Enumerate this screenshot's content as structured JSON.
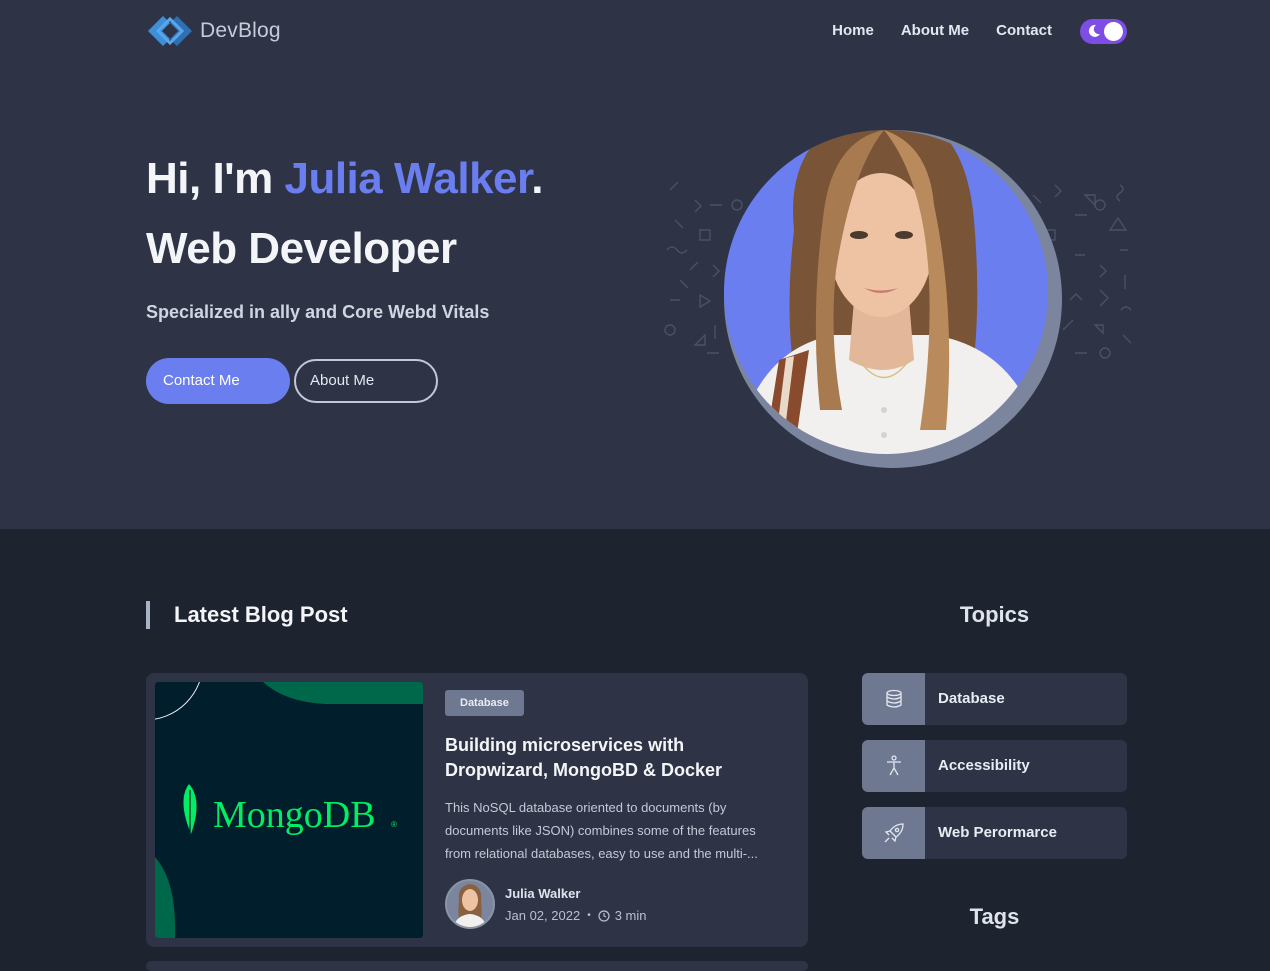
{
  "nav": {
    "brand": "DevBlog",
    "links": [
      {
        "label": "Home"
      },
      {
        "label": "About Me"
      },
      {
        "label": "Contact"
      }
    ],
    "theme_toggle_state": "dark"
  },
  "hero": {
    "greeting": "Hi, I'm ",
    "name": "Julia Walker",
    "name_suffix": ".",
    "role": "Web Developer",
    "subtitle": "Specialized in ally and Core Webd Vitals",
    "primary_button": "Contact Me",
    "secondary_button": "About Me"
  },
  "latest": {
    "section_title": "Latest Blog Post",
    "post": {
      "tag": "Database",
      "title": "Building microservices with Dropwizard, MongoBD & Docker",
      "excerpt": "This NoSQL database oriented to documents (by documents like JSON) combines some of the features from relational databases, easy to use and the multi-...",
      "thumbnail_text": "MongoDB",
      "thumbnail_reg": "®",
      "author": "Julia Walker",
      "date": "Jan 02, 2022",
      "read_time": "3 min"
    }
  },
  "sidebar": {
    "topics_title": "Topics",
    "topics": [
      {
        "label": "Database",
        "icon": "database-icon"
      },
      {
        "label": "Accessibility",
        "icon": "accessibility-icon"
      },
      {
        "label": "Web Perormarce",
        "icon": "rocket-icon"
      }
    ],
    "tags_title": "Tags"
  },
  "colors": {
    "hero_bg": "#2e3445",
    "page_bg": "#1e2330",
    "accent": "#6b7ef0",
    "toggle": "#7d4de6",
    "mongo_green": "#00ed64"
  }
}
